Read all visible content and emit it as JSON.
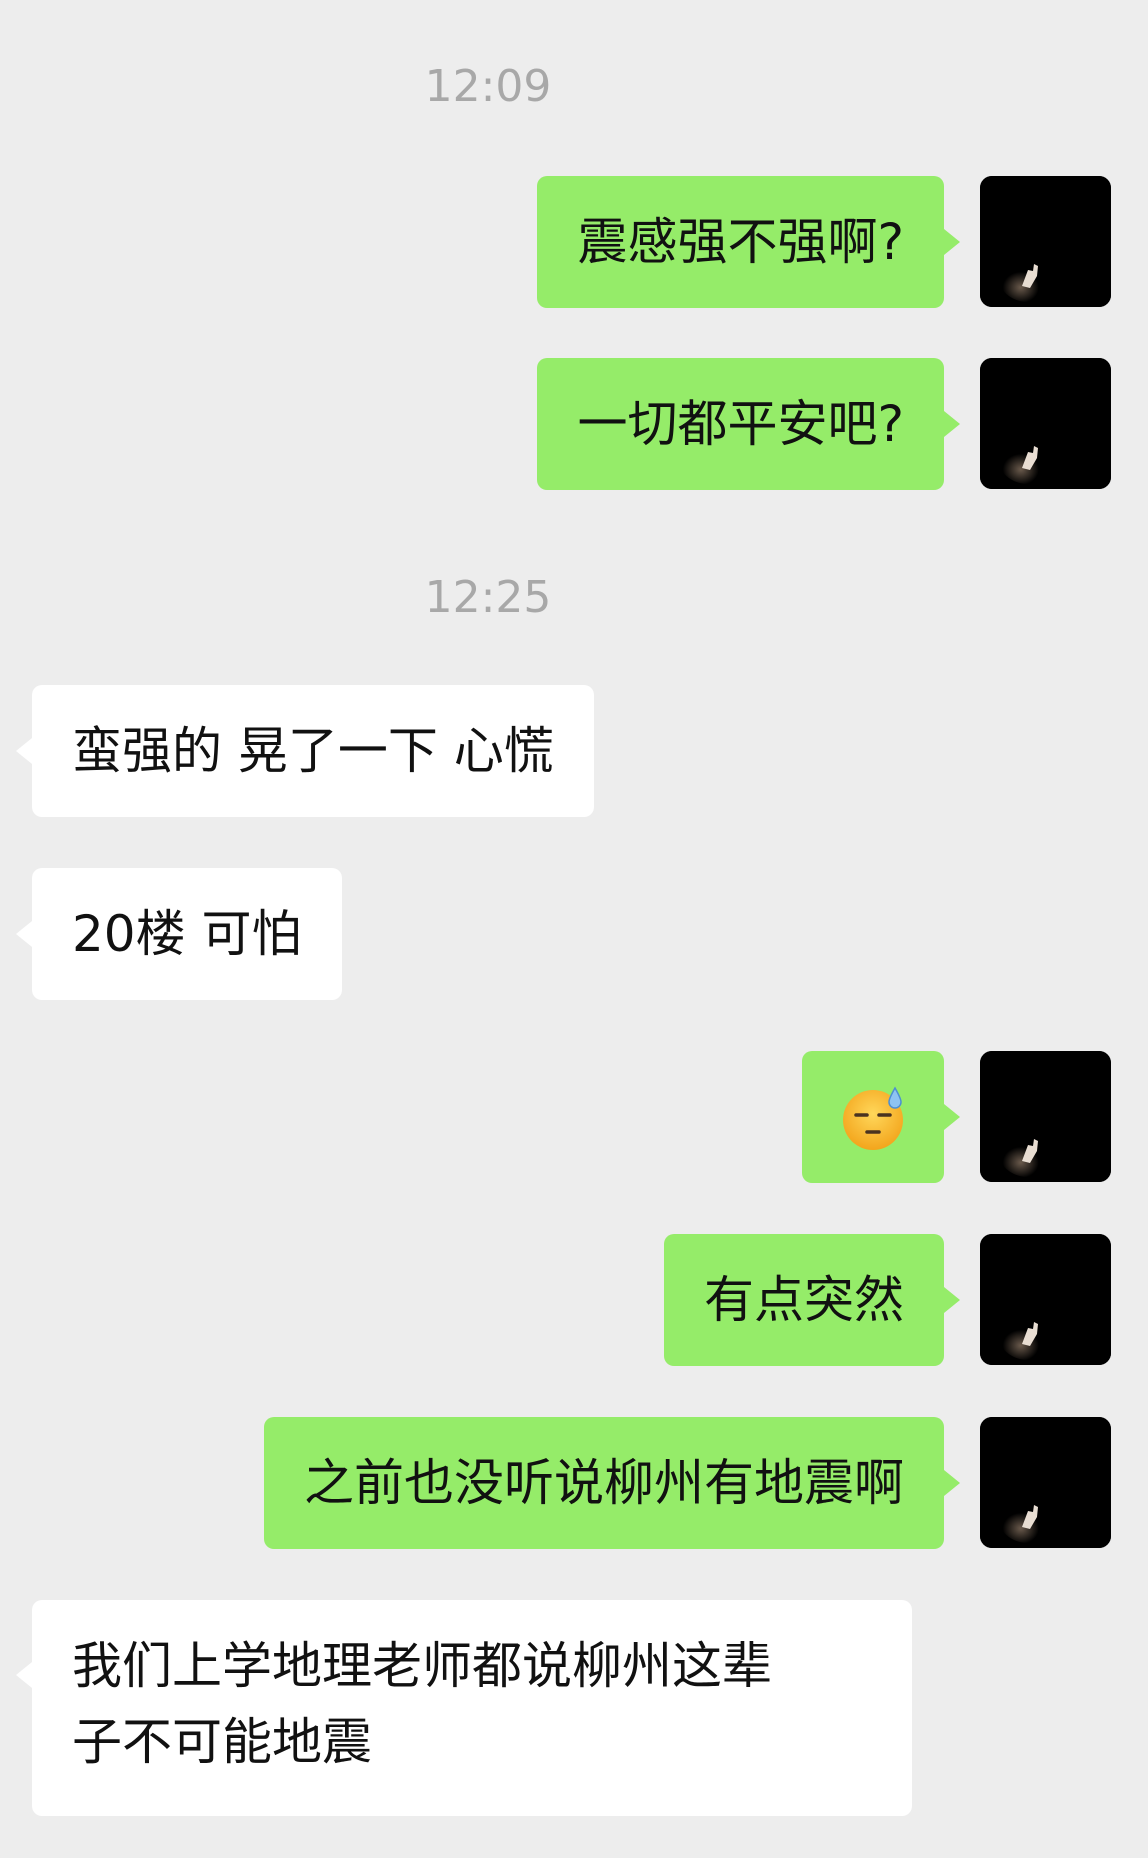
{
  "chat": {
    "timestamps": [
      "12:09",
      "12:25"
    ],
    "messages": [
      {
        "side": "right",
        "text": "震感强不强啊?"
      },
      {
        "side": "right",
        "text": "一切都平安吧?"
      },
      {
        "side": "left",
        "text": "蛮强的 晃了一下 心慌"
      },
      {
        "side": "left",
        "text": "20楼 可怕"
      },
      {
        "side": "right",
        "emoji": "downcast-face-with-sweat-emoji"
      },
      {
        "side": "right",
        "text": "有点突然"
      },
      {
        "side": "right",
        "text": "之前也没听说柳州有地震啊"
      },
      {
        "side": "left",
        "lines": [
          "我们上学地理老师都说柳州这辈",
          "子不可能地震"
        ]
      }
    ]
  },
  "colors": {
    "background": "#ededed",
    "sent_bubble": "#95ec69",
    "received_bubble": "#ffffff",
    "timestamp": "#a8a8a8",
    "text": "#111111"
  },
  "icons": {
    "avatar": "dark-photo-hand-avatar",
    "emoji": "downcast-face-with-sweat-emoji"
  }
}
